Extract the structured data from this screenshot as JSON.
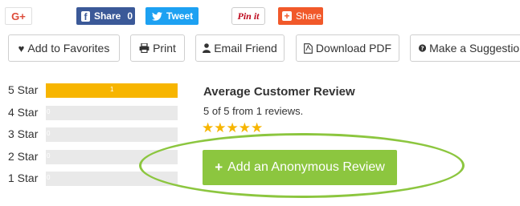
{
  "share": {
    "gplus_label": "G+",
    "facebook_label": "Share",
    "facebook_count": "0",
    "twitter_label": "Tweet",
    "pinterest_label": "Pin it",
    "share_label": "Share"
  },
  "actions": {
    "favorites": "Add to Favorites",
    "print": "Print",
    "email": "Email Friend",
    "pdf": "Download PDF",
    "suggestion": "Make a Suggestion"
  },
  "ratings": [
    {
      "label": "5 Star",
      "count": "1",
      "fraction": 1.0
    },
    {
      "label": "4 Star",
      "count": "0",
      "fraction": 0
    },
    {
      "label": "3 Star",
      "count": "0",
      "fraction": 0
    },
    {
      "label": "2 Star",
      "count": "0",
      "fraction": 0
    },
    {
      "label": "1 Star",
      "count": "0",
      "fraction": 0
    }
  ],
  "review": {
    "title": "Average Customer Review",
    "summary": "5 of 5 from 1 reviews.",
    "stars_rating": 5,
    "stars_display": "★★★★★",
    "add_button": "Add an Anonymous Review"
  },
  "colors": {
    "accent_green": "#8cc63f",
    "bar_fill": "#f7b500",
    "facebook": "#3b5998",
    "twitter": "#1da1f2",
    "google": "#dd4b39",
    "share": "#f1592a"
  }
}
